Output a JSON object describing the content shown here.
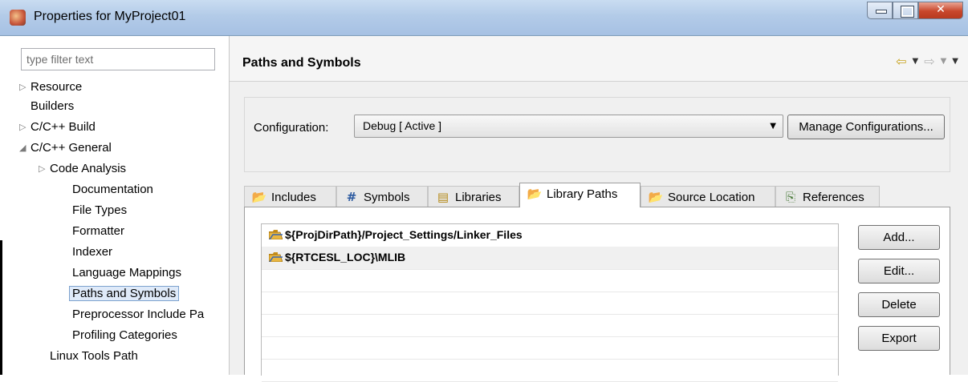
{
  "window": {
    "title": "Properties for MyProject01",
    "icon": "app-icon"
  },
  "filter": {
    "placeholder": "type filter text"
  },
  "tree": [
    {
      "label": "Resource",
      "arrow": "▷"
    },
    {
      "label": "Builders",
      "arrow": ""
    },
    {
      "label": "C/C++ Build",
      "arrow": "▷"
    },
    {
      "label": "C/C++ General",
      "arrow": "◢"
    },
    {
      "label": "Code Analysis",
      "arrow": "▷"
    },
    {
      "label": "Documentation",
      "arrow": ""
    },
    {
      "label": "File Types",
      "arrow": ""
    },
    {
      "label": "Formatter",
      "arrow": ""
    },
    {
      "label": "Indexer",
      "arrow": ""
    },
    {
      "label": "Language Mappings",
      "arrow": ""
    },
    {
      "label": "Paths and Symbols",
      "arrow": "",
      "selected": true
    },
    {
      "label": "Preprocessor Include Pa",
      "arrow": ""
    },
    {
      "label": "Profiling Categories",
      "arrow": ""
    },
    {
      "label": "Linux Tools Path",
      "arrow": ""
    }
  ],
  "page": {
    "title": "Paths and Symbols"
  },
  "config": {
    "label": "Configuration:",
    "value": "Debug  [ Active ]",
    "manage_label": "Manage Configurations..."
  },
  "tabs": [
    {
      "label": "Includes",
      "icon": "include-folder-icon"
    },
    {
      "label": "Symbols",
      "icon": "hash-icon"
    },
    {
      "label": "Libraries",
      "icon": "library-books-icon"
    },
    {
      "label": "Library Paths",
      "icon": "folder-icon",
      "active": true
    },
    {
      "label": "Source Location",
      "icon": "source-folder-icon"
    },
    {
      "label": "References",
      "icon": "references-icon"
    }
  ],
  "paths": [
    {
      "text": "${ProjDirPath}/Project_Settings/Linker_Files"
    },
    {
      "text": "${RTCESL_LOC}\\MLIB"
    }
  ],
  "buttons": {
    "add": "Add...",
    "edit": "Edit...",
    "delete": "Delete",
    "export": "Export"
  },
  "colors": {
    "titlebar": "#b3cbe8",
    "selection": "#dfeaf9",
    "folder": "#e0b030",
    "nav_arrow": "#c7a21c"
  }
}
